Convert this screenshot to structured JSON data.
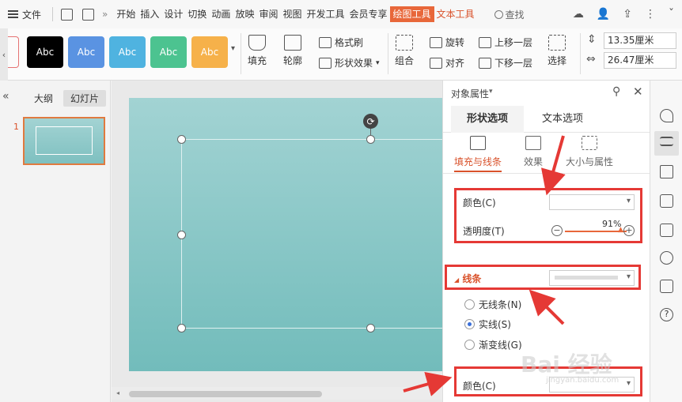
{
  "menubar": {
    "file_label": "文件",
    "more_label": "»",
    "tabs": [
      "开始",
      "插入",
      "设计",
      "切换",
      "动画",
      "放映",
      "审阅",
      "视图",
      "开发工具",
      "会员专享"
    ],
    "active_tab": "绘图工具",
    "text_tool_tab": "文本工具",
    "search_label": "查找"
  },
  "ribbon": {
    "style_boxes": [
      {
        "label": "Abc",
        "color": "#000000"
      },
      {
        "label": "Abc",
        "color": "#5a93e2"
      },
      {
        "label": "Abc",
        "color": "#4fb3e0"
      },
      {
        "label": "Abc",
        "color": "#4cc390"
      },
      {
        "label": "Abc",
        "color": "#f6b14a"
      }
    ],
    "fill_label": "填充",
    "outline_label": "轮廓",
    "format_painter_label": "格式刷",
    "shape_effects_label": "形状效果",
    "group_label": "组合",
    "rotate_label": "旋转",
    "align_label": "对齐",
    "bring_forward_label": "上移一层",
    "send_backward_label": "下移一层",
    "select_label": "选择",
    "height_value": "13.35厘米",
    "width_value": "26.47厘米"
  },
  "left_panel": {
    "outline_tab": "大纲",
    "slides_tab": "幻灯片",
    "slide_number": "1"
  },
  "property_panel": {
    "title": "对象属性",
    "tab_shape": "形状选项",
    "tab_text": "文本选项",
    "sub_fill_line": "填充与线条",
    "sub_effects": "效果",
    "sub_size": "大小与属性",
    "color_label": "颜色(C)",
    "transparency_label": "透明度(T)",
    "transparency_value": "91%",
    "transparency_fraction": 0.91,
    "line_section": "线条",
    "no_line": "无线条(N)",
    "solid_line": "实线(S)",
    "gradient_line": "渐变线(G)",
    "line_color_label": "颜色(C)"
  },
  "watermark": {
    "text": "Bai 经验",
    "sub": "jingyan.baidu.com"
  }
}
